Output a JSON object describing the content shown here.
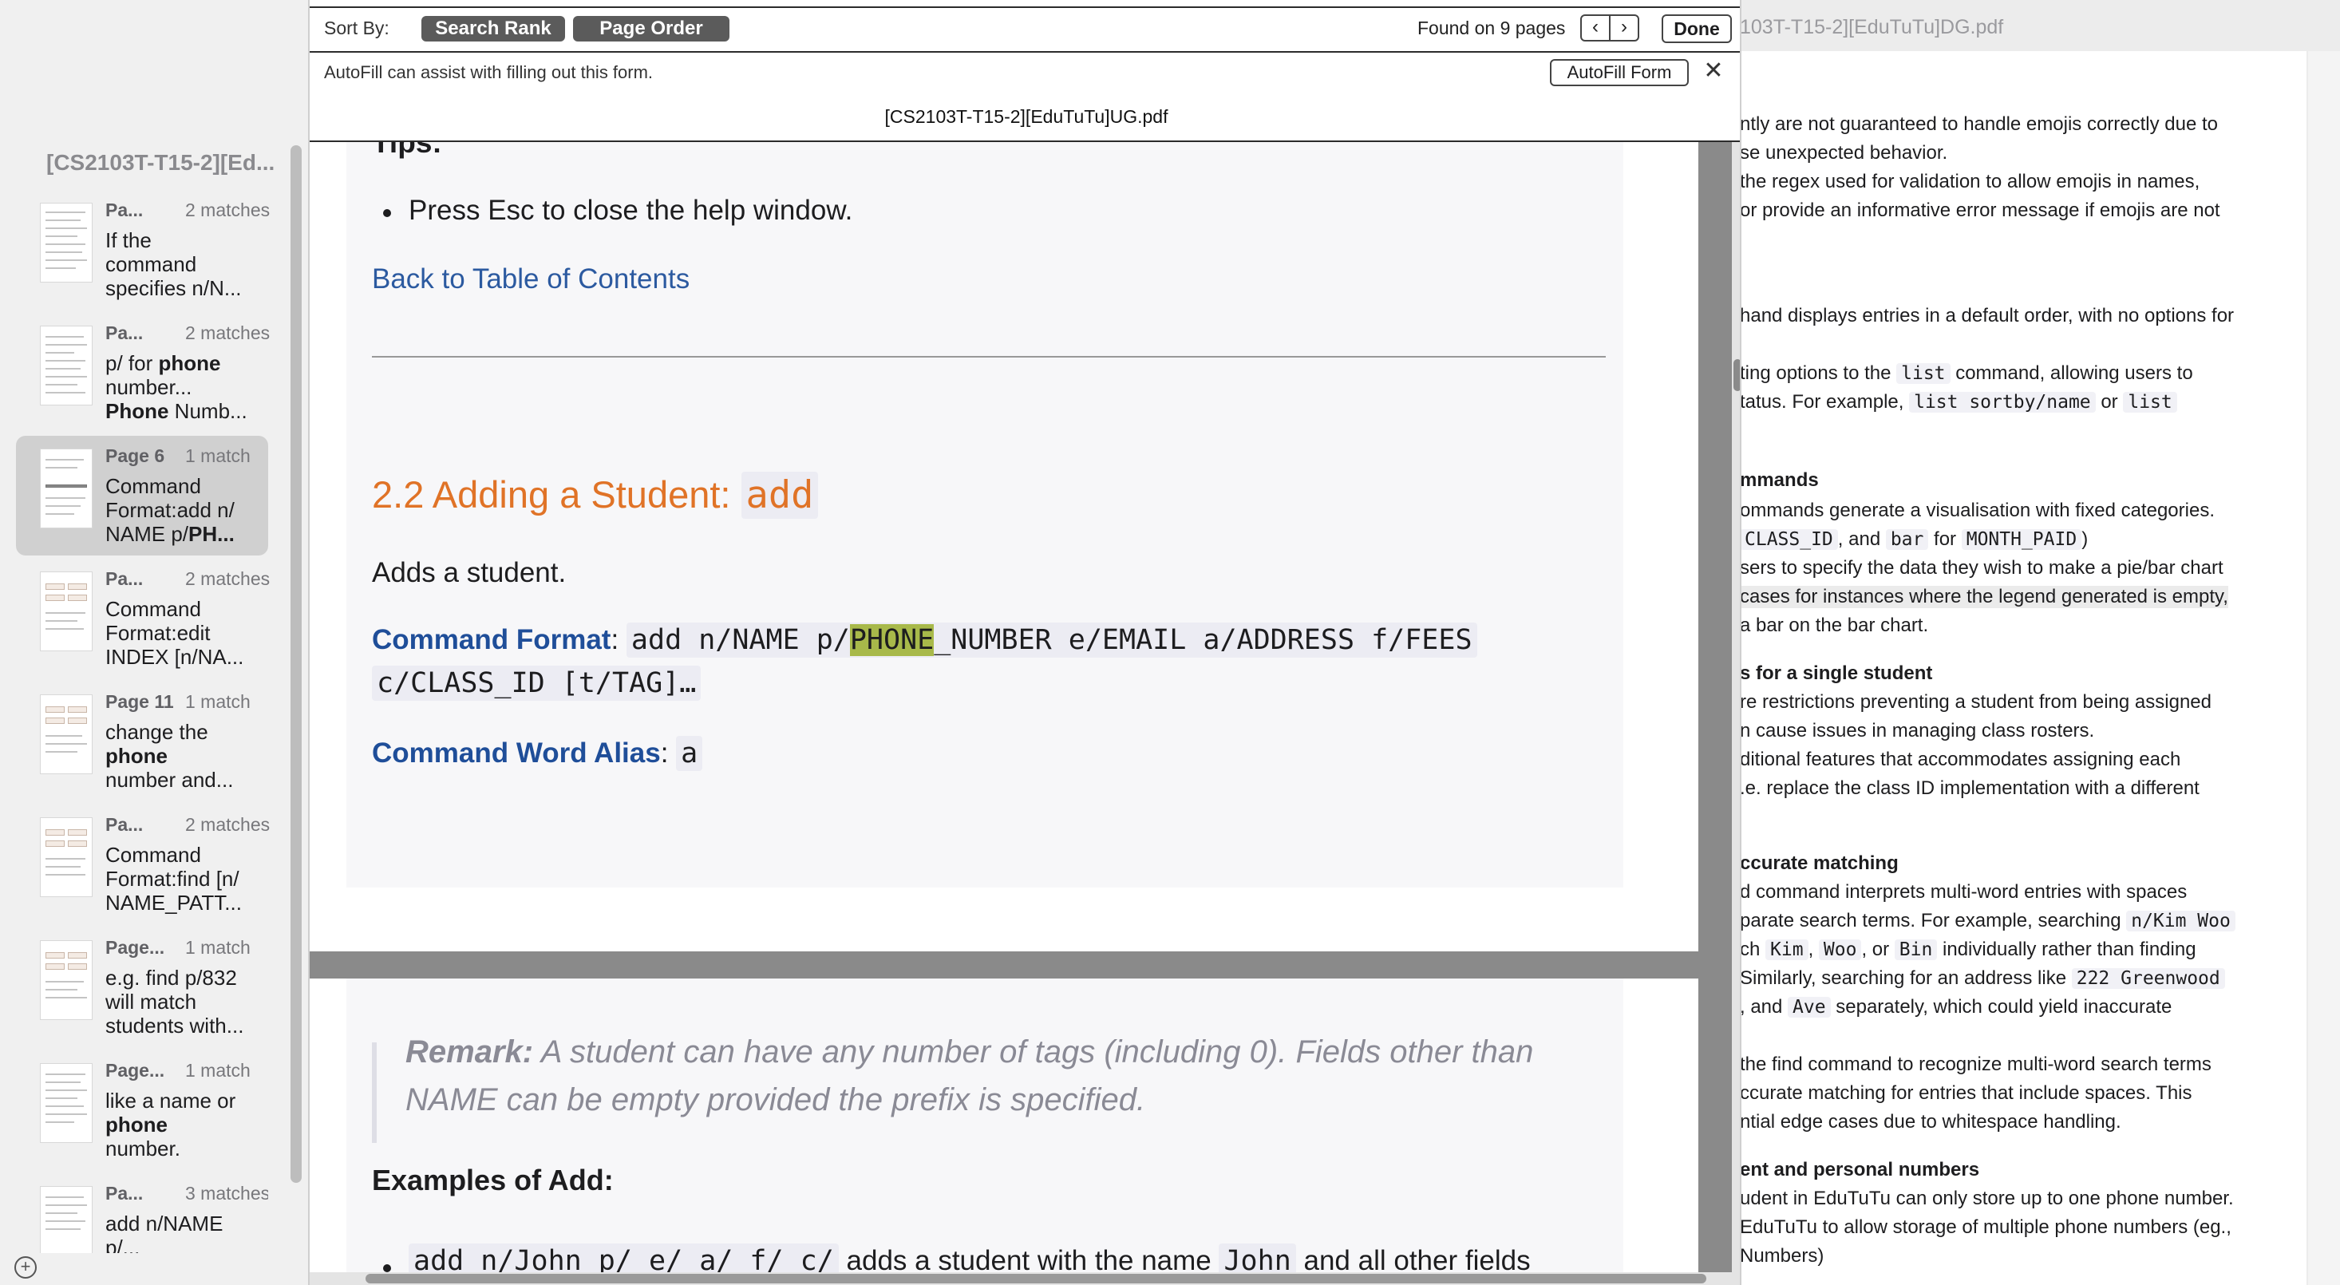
{
  "sidebar": {
    "title": "[CS2103T-T15-2][Ed...",
    "results": [
      {
        "page": "Pa...",
        "matches": "2 matches",
        "snippet": [
          "If the",
          "command",
          "specifies n/N..."
        ],
        "selected": false
      },
      {
        "page": "Pa...",
        "matches": "2 matches",
        "snippet": [
          "p/ for phone",
          "number...",
          "Phone Numb..."
        ],
        "selected": false
      },
      {
        "page": "Page 6",
        "matches": "1 match",
        "snippet": [
          "Command",
          "Format:add n/",
          "NAME p/PH..."
        ],
        "selected": true
      },
      {
        "page": "Pa...",
        "matches": "2 matches",
        "snippet": [
          "Command",
          "Format:edit",
          "INDEX [n/NA..."
        ],
        "selected": false
      },
      {
        "page": "Page 11",
        "matches": "1 match",
        "snippet": [
          "change the",
          "phone",
          "number and..."
        ],
        "selected": false
      },
      {
        "page": "Pa...",
        "matches": "2 matches",
        "snippet": [
          "Command",
          "Format:find [n/",
          "NAME_PATT..."
        ],
        "selected": false
      },
      {
        "page": "Page...",
        "matches": "1 match",
        "snippet": [
          "e.g. find p/832",
          "will match",
          "students with..."
        ],
        "selected": false
      },
      {
        "page": "Page...",
        "matches": "1 match",
        "snippet": [
          "like a name or",
          "phone",
          "number."
        ],
        "selected": false
      },
      {
        "page": "Pa...",
        "matches": "3 matches",
        "snippet": [
          "add n/NAME",
          "p/..."
        ],
        "selected": false
      }
    ],
    "add_icon": "plus-circle-icon"
  },
  "findbar": {
    "sort_label": "Sort By:",
    "sort_options": [
      "Search Rank",
      "Page Order"
    ],
    "found_label": "Found on 9 pages",
    "prev_icon": "chevron-left-icon",
    "next_icon": "chevron-right-icon",
    "done_label": "Done",
    "autofill_message": "AutoFill can assist with filling out this form.",
    "autofill_button": "AutoFill Form",
    "close_icon": "close-icon",
    "document_title": "[CS2103T-T15-2][EduTuTu]UG.pdf"
  },
  "page": {
    "tips_heading": "Tips:",
    "tip_bullet": "Press Esc to close the help window.",
    "back_link": "Back to Table of Contents",
    "section_title": "2.2 Adding a Student: ",
    "section_code": "add",
    "summary": "Adds a student.",
    "format_label": "Command Format",
    "format_code_before": "add n/NAME p/",
    "format_code_match": "PHONE",
    "format_code_after": "_NUMBER e/EMAIL a/ADDRESS f/FEES",
    "format_code_line2": "c/CLASS_ID [t/TAG]…",
    "alias_label": "Command Word Alias",
    "alias_code": "a",
    "remark_label": "Remark:",
    "remark_line1": " A student can have any number of tags (including 0). Fields other than",
    "remark_line2": "NAME can be empty provided the prefix is specified.",
    "examples_heading": "Examples of Add:",
    "example_code": "add n/John p/ e/ a/ f/ c/",
    "example_text_1": " adds a student with the name ",
    "example_code_2": "John",
    "example_text_2": " and all other fields"
  },
  "right_doc": {
    "title": "103T-T15-2][EduTuTu]DG.pdf"
  },
  "colors": {
    "accent_orange": "#e07327",
    "link_blue": "#2c5aa0",
    "match_highlight": "#a8b94a"
  }
}
